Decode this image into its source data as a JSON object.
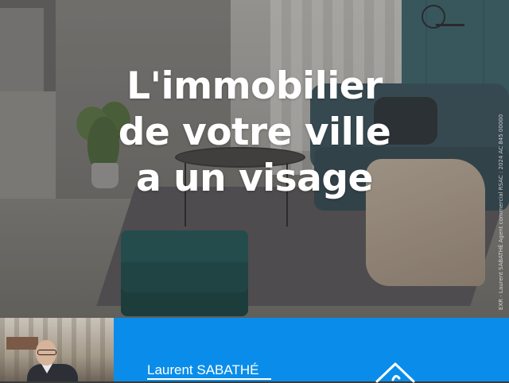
{
  "hero": {
    "headline": [
      "L'immobilier",
      "de votre ville",
      "a un visage"
    ],
    "legal_text": "EXR - Laurent SABATHÉ Agent commercial RSAC : 2024 AC 845 00000"
  },
  "agent": {
    "name": "Laurent SABATHÉ"
  },
  "colors": {
    "brand_blue": "#0a8dea",
    "text_white": "#ffffff"
  },
  "icons": {
    "brand_logo": "house-outline-icon"
  }
}
